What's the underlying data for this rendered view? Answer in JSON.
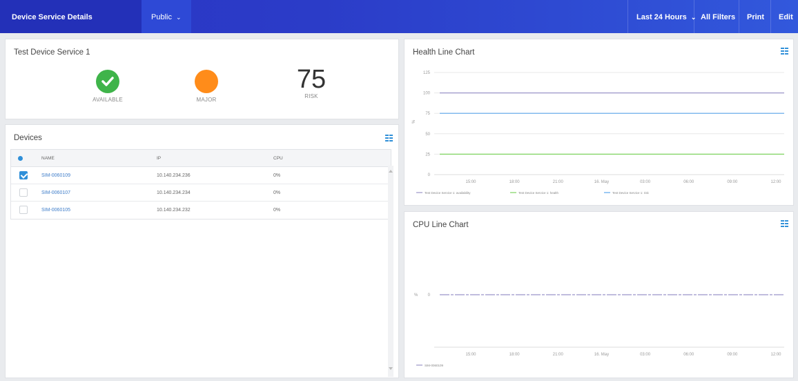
{
  "topbar": {
    "title": "Device Service Details",
    "visibility": "Public",
    "time_range": "Last 24 Hours",
    "filters": "All Filters",
    "print": "Print",
    "edit": "Edit"
  },
  "status": {
    "title": "Test Device Service 1",
    "availability_label": "AVAILABLE",
    "severity_label": "MAJOR",
    "risk_value": "75",
    "risk_label": "RISK",
    "colors": {
      "available": "#3fb44a",
      "major": "#ff8c1a"
    }
  },
  "devices": {
    "title": "Devices",
    "columns": [
      "NAME",
      "IP",
      "CPU"
    ],
    "rows": [
      {
        "name": "SIM-0060109",
        "ip": "10.140.234.236",
        "cpu": "0%",
        "checked": true
      },
      {
        "name": "SIM-0060107",
        "ip": "10.140.234.234",
        "cpu": "0%",
        "checked": false
      },
      {
        "name": "SIM-0060105",
        "ip": "10.140.234.232",
        "cpu": "0%",
        "checked": false
      }
    ]
  },
  "health_chart": {
    "title": "Health Line Chart",
    "ylabel": "%",
    "legend": [
      "Test Device Service 1: availability",
      "Test Device Service 1: health",
      "Test Device Service 1: risk"
    ]
  },
  "cpu_chart": {
    "title": "CPU Line Chart",
    "ylabel": "%",
    "legend": [
      "SIM-0060109"
    ]
  },
  "chart_data": [
    {
      "type": "line",
      "title": "Health Line Chart",
      "ylabel": "%",
      "x": [
        "15:00",
        "18:00",
        "21:00",
        "16. May",
        "03:00",
        "06:00",
        "09:00",
        "12:00"
      ],
      "yticks": [
        0,
        25,
        50,
        75,
        100,
        125
      ],
      "ylim": [
        0,
        125
      ],
      "grid": true,
      "legend_position": "bottom",
      "series": [
        {
          "name": "Test Device Service 1: availability",
          "color": "#9b94c9",
          "values": [
            100,
            100,
            100,
            100,
            100,
            100,
            100,
            100
          ]
        },
        {
          "name": "Test Device Service 1: health",
          "color": "#7dd35f",
          "values": [
            25,
            25,
            25,
            25,
            25,
            25,
            25,
            25
          ]
        },
        {
          "name": "Test Device Service 1: risk",
          "color": "#5ba7ec",
          "values": [
            75,
            75,
            75,
            75,
            75,
            75,
            75,
            75
          ]
        }
      ]
    },
    {
      "type": "line",
      "title": "CPU Line Chart",
      "ylabel": "%",
      "x": [
        "15:00",
        "18:00",
        "21:00",
        "16. May",
        "03:00",
        "06:00",
        "09:00",
        "12:00"
      ],
      "yticks": [
        0
      ],
      "ylim": [
        -1,
        1
      ],
      "grid": false,
      "legend_position": "bottom",
      "series": [
        {
          "name": "SIM-0060109",
          "color": "#9b94c9",
          "values": [
            0,
            0,
            0,
            0,
            0,
            0,
            0,
            0
          ]
        }
      ]
    }
  ]
}
